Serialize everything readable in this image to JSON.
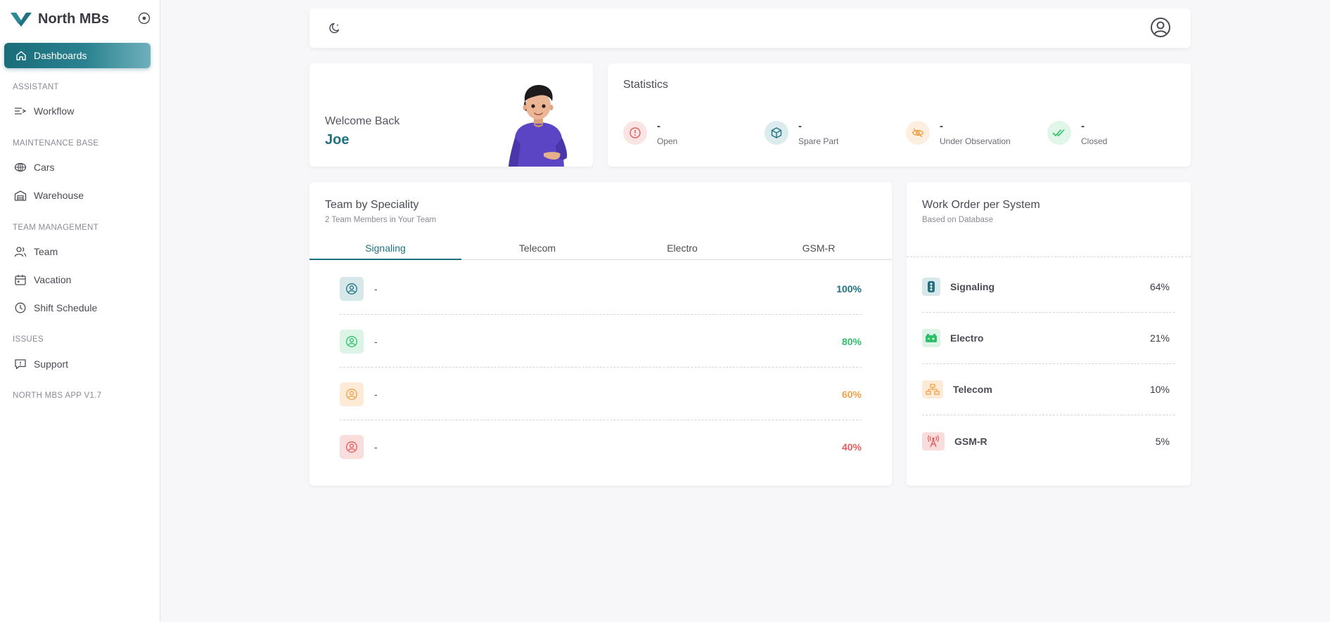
{
  "app": {
    "name": "North MBs"
  },
  "sidebar": {
    "active_item": "Dashboards",
    "sections": [
      {
        "title": "ASSISTANT",
        "items": [
          "Workflow"
        ]
      },
      {
        "title": "MAINTENANCE BASE",
        "items": [
          "Cars",
          "Warehouse"
        ]
      },
      {
        "title": "TEAM MANAGEMENT",
        "items": [
          "Team",
          "Vacation",
          "Shift Schedule"
        ]
      },
      {
        "title": "ISSUES",
        "items": [
          "Support"
        ]
      }
    ],
    "version": "NORTH MBS APP V1.7"
  },
  "welcome": {
    "title": "Welcome Back",
    "name": "Joe"
  },
  "statistics": {
    "title": "Statistics",
    "items": [
      {
        "value": "-",
        "label": "Open",
        "icon": "alert-circle-icon",
        "color": "#e35d5d",
        "bg": "#fbe4e4"
      },
      {
        "value": "-",
        "label": "Spare Part",
        "icon": "cube-icon",
        "color": "#1f7380",
        "bg": "#dcecee"
      },
      {
        "value": "-",
        "label": "Under Observation",
        "icon": "eye-off-icon",
        "color": "#f0a24a",
        "bg": "#fdefe0"
      },
      {
        "value": "-",
        "label": "Closed",
        "icon": "double-check-icon",
        "color": "#2fbf6b",
        "bg": "#dff6e8"
      }
    ]
  },
  "team": {
    "title": "Team by Speciality",
    "subtitle": "2 Team Members in Your Team",
    "tabs": [
      "Signaling",
      "Telecom",
      "Electro",
      "GSM-R"
    ],
    "active_tab": "Signaling",
    "rows": [
      {
        "name": "-",
        "percent": "100%",
        "color": "#1f7380",
        "bg": "#d7e8ea"
      },
      {
        "name": "-",
        "percent": "80%",
        "color": "#2fbf6b",
        "bg": "#dcf4e5"
      },
      {
        "name": "-",
        "percent": "60%",
        "color": "#f0a24a",
        "bg": "#fdebd8"
      },
      {
        "name": "-",
        "percent": "40%",
        "color": "#e35d5d",
        "bg": "#f9dddd"
      }
    ]
  },
  "work_order": {
    "title": "Work Order per System",
    "subtitle": "Based on Database",
    "rows": [
      {
        "name": "Signaling",
        "percent": "64%",
        "icon": "traffic-light-icon",
        "color": "#1f7380",
        "bg": "#d7e8ea"
      },
      {
        "name": "Electro",
        "percent": "21%",
        "icon": "battery-icon",
        "color": "#2fbf6b",
        "bg": "#dcf4e5"
      },
      {
        "name": "Telecom",
        "percent": "10%",
        "icon": "network-icon",
        "color": "#f0a24a",
        "bg": "#fdebd8"
      },
      {
        "name": "GSM-R",
        "percent": "5%",
        "icon": "antenna-icon",
        "color": "#e35d5d",
        "bg": "#f9dddd"
      }
    ]
  }
}
